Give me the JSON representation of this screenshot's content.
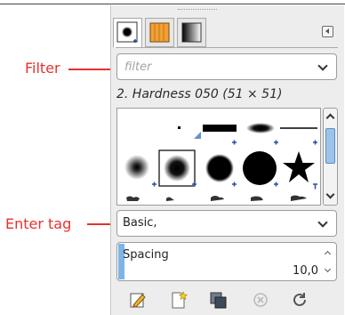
{
  "annotations": [
    {
      "label": "Filter"
    },
    {
      "label": "Enter tag"
    }
  ],
  "panel": {
    "tabs": [
      {
        "icon": "brush-icon",
        "active": true
      },
      {
        "icon": "pattern-icon",
        "active": false
      },
      {
        "icon": "gradient-icon",
        "active": false
      }
    ],
    "tab_menu_icon": "panel-menu-icon"
  },
  "filter": {
    "placeholder": "filter",
    "value": ""
  },
  "brush": {
    "title": "2. Hardness 050 (51 × 51)"
  },
  "brushes_grid": {
    "selected_index": 6
  },
  "tag": {
    "value": "Basic,"
  },
  "spacing": {
    "label": "Spacing",
    "value": "10,0",
    "fill_fraction": 0.03
  },
  "toolbar": {
    "buttons": [
      "edit-brush-icon",
      "new-brush-icon",
      "duplicate-brush-icon",
      "delete-brush-icon",
      "refresh-brushes-icon"
    ],
    "disabled": [
      "delete-brush-icon"
    ]
  },
  "colors": {
    "annotation": "#e5322d",
    "accent": "#7fb4e6"
  }
}
